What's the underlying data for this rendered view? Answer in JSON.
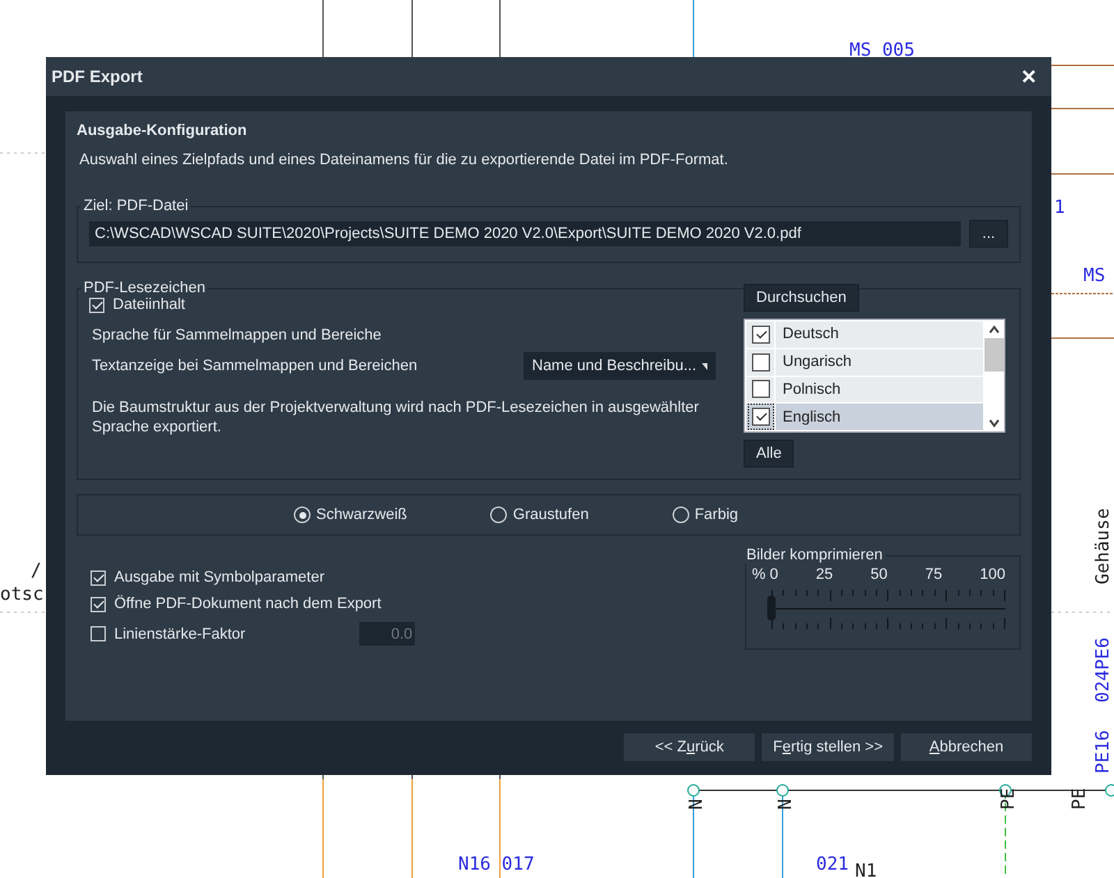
{
  "drawing": {
    "labels": [
      {
        "text": "MS 005",
        "kind": "ref"
      },
      {
        "text": "1",
        "kind": "ref"
      },
      {
        "text": "MS",
        "kind": "ref"
      },
      {
        "text": "/",
        "kind": "plain"
      },
      {
        "text": "otsc",
        "kind": "plain"
      },
      {
        "text": "Gehäuse",
        "kind": "plain"
      },
      {
        "text": "024PE6",
        "kind": "ref"
      },
      {
        "text": "PE16",
        "kind": "ref"
      },
      {
        "text": "N16 017",
        "kind": "ref"
      },
      {
        "text": "021",
        "kind": "ref"
      },
      {
        "text": "N1",
        "kind": "plain"
      },
      {
        "text": "N",
        "kind": "plain"
      },
      {
        "text": "N",
        "kind": "plain"
      },
      {
        "text": "PE",
        "kind": "plain"
      },
      {
        "text": "PE",
        "kind": "plain"
      }
    ]
  },
  "dialog": {
    "title": "PDF Export",
    "close": "✕",
    "section_title": "Ausgabe-Konfiguration",
    "description": "Auswahl eines Zielpfads und eines Dateinamens für die zu exportierende Datei im PDF-Format.",
    "target": {
      "legend": "Ziel: PDF-Datei",
      "path": "C:\\WSCAD\\WSCAD SUITE\\2020\\Projects\\SUITE DEMO 2020 V2.0\\Export\\SUITE DEMO 2020 V2.0.pdf",
      "browse": "..."
    },
    "bookmarks": {
      "legend": "PDF-Lesezeichen",
      "file_content": {
        "label": "Dateiinhalt",
        "checked": true
      },
      "language_label": "Sprache für Sammelmappen und Bereiche",
      "text_display_label": "Textanzeige bei Sammelmappen und Bereichen",
      "text_display_value": "Name und Beschreibu...",
      "note": "Die Baumstruktur aus der Projektverwaltung wird nach PDF-Lesezeichen in ausgewählter Sprache exportiert.",
      "search_button": "Durchsuchen",
      "languages": [
        {
          "label": "Deutsch",
          "checked": true,
          "selected": false
        },
        {
          "label": "Ungarisch",
          "checked": false,
          "selected": false
        },
        {
          "label": "Polnisch",
          "checked": false,
          "selected": false
        },
        {
          "label": "Englisch",
          "checked": true,
          "selected": true
        }
      ],
      "all_button": "Alle"
    },
    "color_modes": [
      {
        "label": "Schwarzweiß",
        "selected": true
      },
      {
        "label": "Graustufen",
        "selected": false
      },
      {
        "label": "Farbig",
        "selected": false
      }
    ],
    "options": [
      {
        "label": "Ausgabe mit Symbolparameter",
        "checked": true
      },
      {
        "label": "Öffne PDF-Dokument nach dem Export",
        "checked": true
      },
      {
        "label": "Linienstärke-Faktor",
        "checked": false,
        "value": "0.0"
      }
    ],
    "compression": {
      "legend": "Bilder komprimieren",
      "unit": "%",
      "ticks": [
        "0",
        "25",
        "50",
        "75",
        "100"
      ],
      "level": 0
    },
    "buttons": [
      {
        "label": "<< Zurück"
      },
      {
        "label": "Fertig stellen >>"
      },
      {
        "label": "Abbrechen"
      }
    ]
  }
}
